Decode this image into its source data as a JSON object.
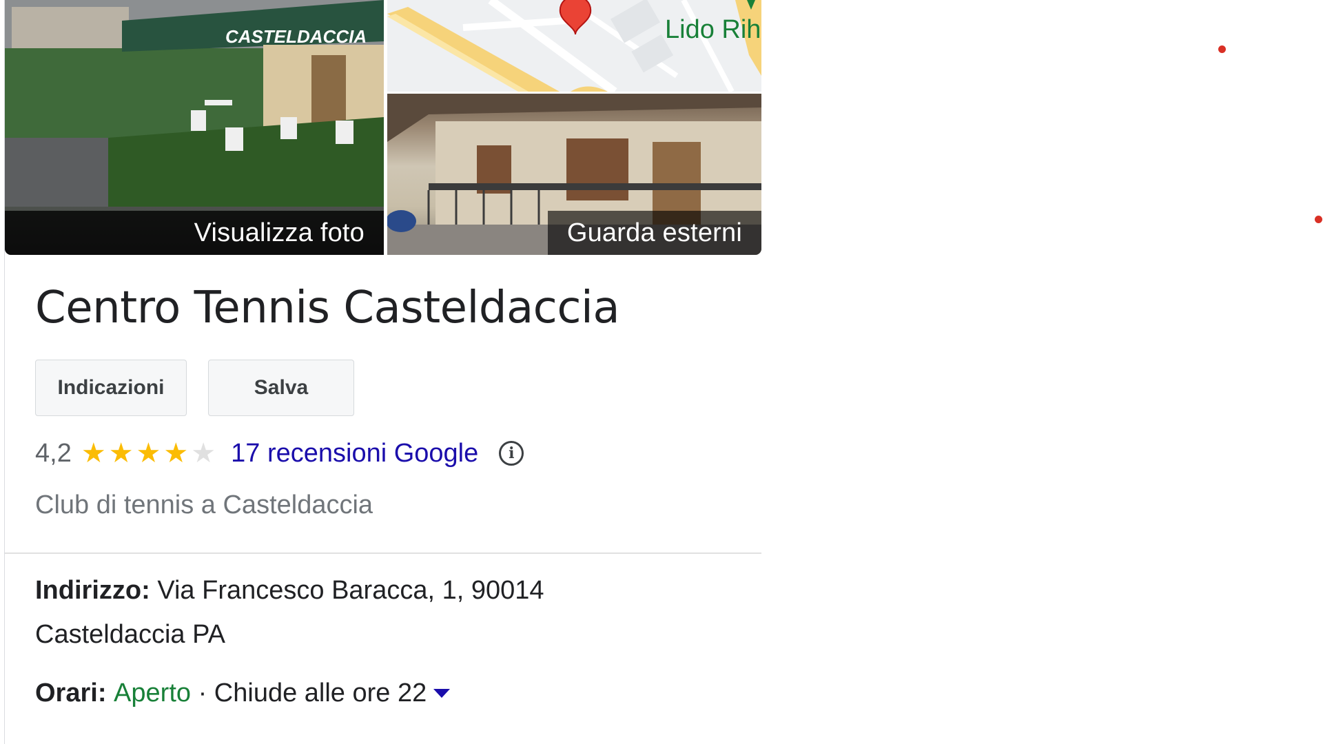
{
  "photos": {
    "view_photos_label": "Visualizza foto",
    "view_exterior_label": "Guarda esterni",
    "sign_text": "CASTELDACCIA"
  },
  "map": {
    "place_label": "Lido Rih"
  },
  "place": {
    "title": "Centro Tennis Casteldaccia",
    "category": "Club di tennis a Casteldaccia"
  },
  "actions": {
    "directions_label": "Indicazioni",
    "save_label": "Salva"
  },
  "rating": {
    "value": "4,2",
    "score": 4.2,
    "stars_max": 5,
    "reviews_label": "17 recensioni Google"
  },
  "details": {
    "address_label": "Indirizzo:",
    "address_line1": "Via Francesco Baracca, 1, 90014",
    "address_line2": "Casteldaccia PA",
    "hours_label": "Orari:",
    "hours_status": "Aperto",
    "hours_separator": "·",
    "hours_close": "Chiude alle ore 22"
  },
  "colors": {
    "star": "#fbbc04",
    "link": "#1a0dab",
    "open": "#188038",
    "marker": "#ea4335"
  }
}
